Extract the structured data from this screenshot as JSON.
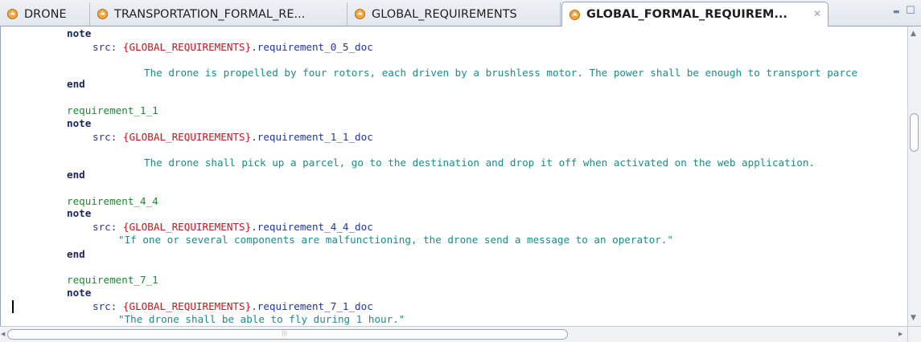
{
  "tabs": [
    {
      "label": "DRONE",
      "active": false
    },
    {
      "label": "TRANSPORTATION_FORMAL_RE...",
      "active": false
    },
    {
      "label": "GLOBAL_REQUIREMENTS",
      "active": false
    },
    {
      "label": "GLOBAL_FORMAL_REQUIREM...",
      "active": true
    }
  ],
  "tab_close_glyph": "✕",
  "window_controls": {
    "minimize": "▬",
    "maximize": "☐"
  },
  "colors": {
    "keyword": "#17255c",
    "identifier": "#1e8a2e",
    "source_ref": "#2236a0",
    "brace": "#c21818",
    "doc_text": "#1c8a8a",
    "tab_icon": "#f0a040"
  },
  "editor": {
    "blocks": [
      {
        "requirement": "",
        "note": "note",
        "src_prefix": "src: ",
        "src_ref": "{GLOBAL_REQUIREMENTS}",
        "src_suffix": ".requirement_0_5_doc",
        "doc": "The drone is propelled by four rotors, each driven by a brushless motor. The power shall be enough to transport parce",
        "end": "end"
      },
      {
        "requirement": "requirement_1_1",
        "note": "note",
        "src_prefix": "src: ",
        "src_ref": "{GLOBAL_REQUIREMENTS}",
        "src_suffix": ".requirement_1_1_doc",
        "doc": "The drone shall pick up a parcel, go to the destination and drop it off when activated on the web application.",
        "end": "end"
      },
      {
        "requirement": "requirement_4_4",
        "note": "note",
        "src_prefix": "src: ",
        "src_ref": "{GLOBAL_REQUIREMENTS}",
        "src_suffix": ".requirement_4_4_doc",
        "doc": "\"If one or several components are malfunctioning, the drone send a message to an operator.\"",
        "end": "end"
      },
      {
        "requirement": "requirement_7_1",
        "note": "note",
        "src_prefix": "src: ",
        "src_ref": "{GLOBAL_REQUIREMENTS}",
        "src_suffix": ".requirement_7_1_doc",
        "doc": "\"The drone shall be able to fly during 1 hour.\"",
        "end": ""
      }
    ]
  },
  "scroll": {
    "up": "▲",
    "down": "▼",
    "left": "◀",
    "right": "▶",
    "grip": "|||"
  }
}
